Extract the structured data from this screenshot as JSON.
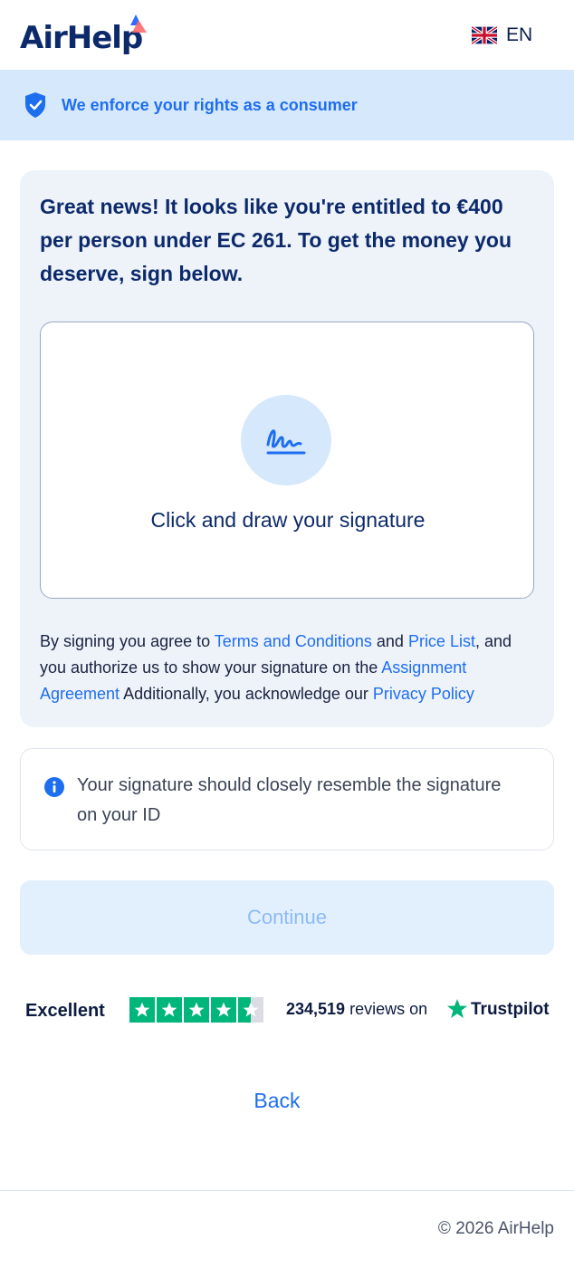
{
  "header": {
    "logo_text": "AirHelp",
    "language_label": "EN",
    "flag_icon": "uk-flag-icon"
  },
  "banner": {
    "text": "We enforce your rights as a consumer",
    "icon": "shield-check-icon"
  },
  "card": {
    "headline": "Great news! It looks like you're entitled to €400 per person under EC 261. To get the money you deserve, sign below.",
    "signature_label": "Click and draw your signature",
    "signature_icon": "signature-icon",
    "terms": {
      "prefix": "By signing you agree to ",
      "terms_link": "Terms and Conditions",
      "and": " and ",
      "price_link": "Price List",
      "middle": ", and you authorize us to show your signature on the ",
      "assignment_link": "Assignment Agreement",
      "after": " Additionally, you acknowledge our ",
      "privacy_link": "Privacy Policy"
    }
  },
  "info": {
    "text": "Your signature should closely resemble the signature on your ID",
    "icon": "info-icon"
  },
  "continue_label": "Continue",
  "trustpilot": {
    "rating_label": "Excellent",
    "stars": 4.5,
    "review_count": "234,519",
    "reviews_on": "reviews on",
    "brand": "Trustpilot"
  },
  "back_label": "Back",
  "footer": {
    "copyright": "© 2026 AirHelp"
  },
  "colors": {
    "brand_blue": "#1e6ef0",
    "navy": "#0c2a6b",
    "banner_bg": "#d6e8fc",
    "card_bg": "#eef3fa",
    "trustpilot_green": "#00b67a"
  }
}
